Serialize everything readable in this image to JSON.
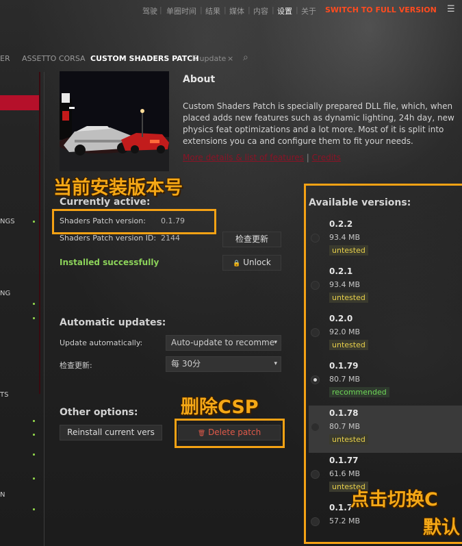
{
  "top_nav": {
    "items": [
      "驾驶",
      "单圈时间",
      "结果",
      "媒体",
      "内容",
      "设置",
      "关于"
    ],
    "active": "设置",
    "upgrade": "SWITCH TO FULL VERSION",
    "menu_glyph": "☰"
  },
  "tabs": {
    "left_cut": "ER",
    "assetto": "ASSETTO CORSA",
    "csp": "CUSTOM SHADERS PATCH",
    "update": "⠿ update",
    "close": "×",
    "search_glyph": "⌕"
  },
  "rail": {
    "labels": [
      "NGS",
      "NG",
      "TS",
      "N"
    ]
  },
  "about": {
    "title": "About",
    "text": "Custom Shaders Patch is specially prepared DLL file, which, when placed adds new features such as dynamic lighting, 24h day, new physics feat optimizations and a lot more. Most of it is split into extensions you ca and configure them to fit your needs.",
    "link1": "More details & list of features",
    "pipe": "|",
    "link2": "Credits"
  },
  "current": {
    "heading": "Currently active:",
    "version_label": "Shaders Patch version:",
    "version_value": "0.1.79",
    "id_label": "Shaders Patch version ID:",
    "id_value": "2144",
    "check_button": "检查更新",
    "status": "Installed successfully",
    "unlock_button": "Unlock",
    "lock_glyph": "🔒"
  },
  "auto": {
    "heading": "Automatic updates:",
    "update_label": "Update automatically:",
    "update_value": "Auto-update to recomme",
    "check_label": "检查更新:",
    "check_value": "每 30分",
    "caret": "▾"
  },
  "other": {
    "heading": "Other options:",
    "reinstall_button": "Reinstall current vers",
    "delete_button": "Delete patch",
    "trash_glyph": "🗑"
  },
  "annotations": {
    "version_callout": "当前安装版本号",
    "delete_callout": "删除CSP",
    "switch_callout": "点击切换C",
    "switch_callout_2": "默认"
  },
  "versions": {
    "heading": "Available versions:",
    "selected": "0.1.79",
    "highlighted": "0.1.78",
    "items": [
      {
        "version": "0.2.2",
        "size": "93.4 MB",
        "tag": "untested"
      },
      {
        "version": "0.2.1",
        "size": "93.4 MB",
        "tag": "untested"
      },
      {
        "version": "0.2.0",
        "size": "92.0 MB",
        "tag": "untested"
      },
      {
        "version": "0.1.79",
        "size": "80.7 MB",
        "tag": "recommended"
      },
      {
        "version": "0.1.78",
        "size": "80.7 MB",
        "tag": "untested"
      },
      {
        "version": "0.1.77",
        "size": "61.6 MB",
        "tag": "untested"
      },
      {
        "version": "0.1.7",
        "size": "57.2 MB",
        "tag": ""
      }
    ]
  },
  "colors": {
    "accent": "#b5102a",
    "upgrade": "#ff4b1f",
    "callout": "#f5a214",
    "success": "#8cd35a",
    "untested": "#e8d04a"
  }
}
